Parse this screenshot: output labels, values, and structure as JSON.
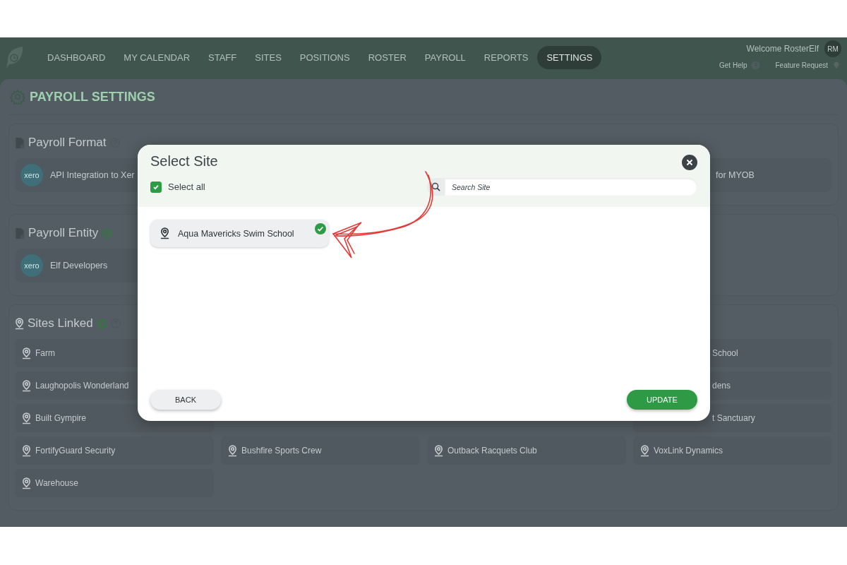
{
  "nav": {
    "items": [
      {
        "label": "DASHBOARD",
        "selected": false
      },
      {
        "label": "MY CALENDAR",
        "selected": false
      },
      {
        "label": "STAFF",
        "selected": false
      },
      {
        "label": "SITES",
        "selected": false
      },
      {
        "label": "POSITIONS",
        "selected": false
      },
      {
        "label": "ROSTER",
        "selected": false
      },
      {
        "label": "PAYROLL",
        "selected": false
      },
      {
        "label": "REPORTS",
        "selected": false
      },
      {
        "label": "SETTINGS",
        "selected": true
      }
    ],
    "welcome": "Welcome RosterElf",
    "avatar": "RM",
    "links": [
      {
        "label": "Get Help",
        "kind": "help"
      },
      {
        "label": "Feature Request",
        "kind": "idea"
      }
    ]
  },
  "page_title": "PAYROLL SETTINGS",
  "payroll_format": {
    "title": "Payroll Format",
    "cards": [
      {
        "logo": "xero",
        "text": "API Integration to Xer"
      },
      {
        "text": "for MYOB"
      }
    ]
  },
  "payroll_entity": {
    "title": "Payroll Entity",
    "cards": [
      {
        "logo": "xero",
        "text": "Elf Developers"
      }
    ]
  },
  "sites_linked": {
    "title": "Sites Linked",
    "rows": [
      [
        "Farm",
        "School"
      ],
      [
        "Laughopolis Wonderland",
        "dens"
      ],
      [
        "Built Gympire",
        "t Sanctuary"
      ],
      [
        "FortifyGuard Security",
        "Bushfire Sports Crew",
        "Outback Racquets Club",
        "VoxLink Dynamics"
      ],
      [
        "Warehouse"
      ]
    ]
  },
  "dialog": {
    "title": "Select Site",
    "select_all": {
      "label": "Select all",
      "checked": true
    },
    "search": {
      "placeholder": "Search Site"
    },
    "sites": [
      {
        "name": "Aqua Mavericks Swim School",
        "selected": true
      }
    ],
    "buttons": [
      {
        "label": "BACK",
        "kind": "secondary"
      },
      {
        "label": "UPDATE",
        "kind": "primary"
      }
    ]
  }
}
